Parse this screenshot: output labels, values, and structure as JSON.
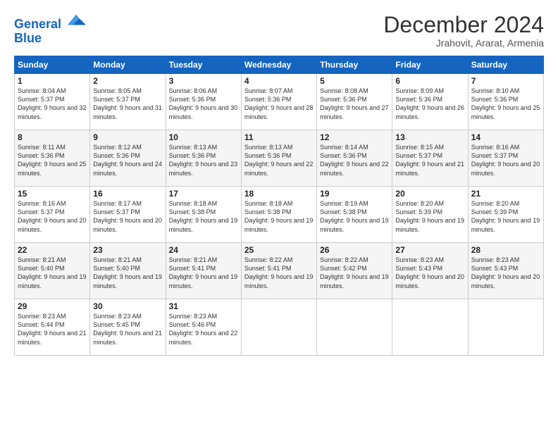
{
  "logo": {
    "line1": "General",
    "line2": "Blue"
  },
  "header": {
    "month_year": "December 2024",
    "location": "Jrahovit, Ararat, Armenia"
  },
  "days_of_week": [
    "Sunday",
    "Monday",
    "Tuesday",
    "Wednesday",
    "Thursday",
    "Friday",
    "Saturday"
  ],
  "weeks": [
    [
      {
        "day": "1",
        "sunrise": "8:04 AM",
        "sunset": "5:37 PM",
        "daylight": "9 hours and 32 minutes."
      },
      {
        "day": "2",
        "sunrise": "8:05 AM",
        "sunset": "5:37 PM",
        "daylight": "9 hours and 31 minutes."
      },
      {
        "day": "3",
        "sunrise": "8:06 AM",
        "sunset": "5:36 PM",
        "daylight": "9 hours and 30 minutes."
      },
      {
        "day": "4",
        "sunrise": "8:07 AM",
        "sunset": "5:36 PM",
        "daylight": "9 hours and 28 minutes."
      },
      {
        "day": "5",
        "sunrise": "8:08 AM",
        "sunset": "5:36 PM",
        "daylight": "9 hours and 27 minutes."
      },
      {
        "day": "6",
        "sunrise": "8:09 AM",
        "sunset": "5:36 PM",
        "daylight": "9 hours and 26 minutes."
      },
      {
        "day": "7",
        "sunrise": "8:10 AM",
        "sunset": "5:36 PM",
        "daylight": "9 hours and 25 minutes."
      }
    ],
    [
      {
        "day": "8",
        "sunrise": "8:11 AM",
        "sunset": "5:36 PM",
        "daylight": "9 hours and 25 minutes."
      },
      {
        "day": "9",
        "sunrise": "8:12 AM",
        "sunset": "5:36 PM",
        "daylight": "9 hours and 24 minutes."
      },
      {
        "day": "10",
        "sunrise": "8:13 AM",
        "sunset": "5:36 PM",
        "daylight": "9 hours and 23 minutes."
      },
      {
        "day": "11",
        "sunrise": "8:13 AM",
        "sunset": "5:36 PM",
        "daylight": "9 hours and 22 minutes."
      },
      {
        "day": "12",
        "sunrise": "8:14 AM",
        "sunset": "5:36 PM",
        "daylight": "9 hours and 22 minutes."
      },
      {
        "day": "13",
        "sunrise": "8:15 AM",
        "sunset": "5:37 PM",
        "daylight": "9 hours and 21 minutes."
      },
      {
        "day": "14",
        "sunrise": "8:16 AM",
        "sunset": "5:37 PM",
        "daylight": "9 hours and 20 minutes."
      }
    ],
    [
      {
        "day": "15",
        "sunrise": "8:16 AM",
        "sunset": "5:37 PM",
        "daylight": "9 hours and 20 minutes."
      },
      {
        "day": "16",
        "sunrise": "8:17 AM",
        "sunset": "5:37 PM",
        "daylight": "9 hours and 20 minutes."
      },
      {
        "day": "17",
        "sunrise": "8:18 AM",
        "sunset": "5:38 PM",
        "daylight": "9 hours and 19 minutes."
      },
      {
        "day": "18",
        "sunrise": "8:18 AM",
        "sunset": "5:38 PM",
        "daylight": "9 hours and 19 minutes."
      },
      {
        "day": "19",
        "sunrise": "8:19 AM",
        "sunset": "5:38 PM",
        "daylight": "9 hours and 19 minutes."
      },
      {
        "day": "20",
        "sunrise": "8:20 AM",
        "sunset": "5:39 PM",
        "daylight": "9 hours and 19 minutes."
      },
      {
        "day": "21",
        "sunrise": "8:20 AM",
        "sunset": "5:39 PM",
        "daylight": "9 hours and 19 minutes."
      }
    ],
    [
      {
        "day": "22",
        "sunrise": "8:21 AM",
        "sunset": "5:40 PM",
        "daylight": "9 hours and 19 minutes."
      },
      {
        "day": "23",
        "sunrise": "8:21 AM",
        "sunset": "5:40 PM",
        "daylight": "9 hours and 19 minutes."
      },
      {
        "day": "24",
        "sunrise": "8:21 AM",
        "sunset": "5:41 PM",
        "daylight": "9 hours and 19 minutes."
      },
      {
        "day": "25",
        "sunrise": "8:22 AM",
        "sunset": "5:41 PM",
        "daylight": "9 hours and 19 minutes."
      },
      {
        "day": "26",
        "sunrise": "8:22 AM",
        "sunset": "5:42 PM",
        "daylight": "9 hours and 19 minutes."
      },
      {
        "day": "27",
        "sunrise": "8:23 AM",
        "sunset": "5:43 PM",
        "daylight": "9 hours and 20 minutes."
      },
      {
        "day": "28",
        "sunrise": "8:23 AM",
        "sunset": "5:43 PM",
        "daylight": "9 hours and 20 minutes."
      }
    ],
    [
      {
        "day": "29",
        "sunrise": "8:23 AM",
        "sunset": "5:44 PM",
        "daylight": "9 hours and 21 minutes."
      },
      {
        "day": "30",
        "sunrise": "8:23 AM",
        "sunset": "5:45 PM",
        "daylight": "9 hours and 21 minutes."
      },
      {
        "day": "31",
        "sunrise": "8:23 AM",
        "sunset": "5:46 PM",
        "daylight": "9 hours and 22 minutes."
      },
      null,
      null,
      null,
      null
    ]
  ]
}
